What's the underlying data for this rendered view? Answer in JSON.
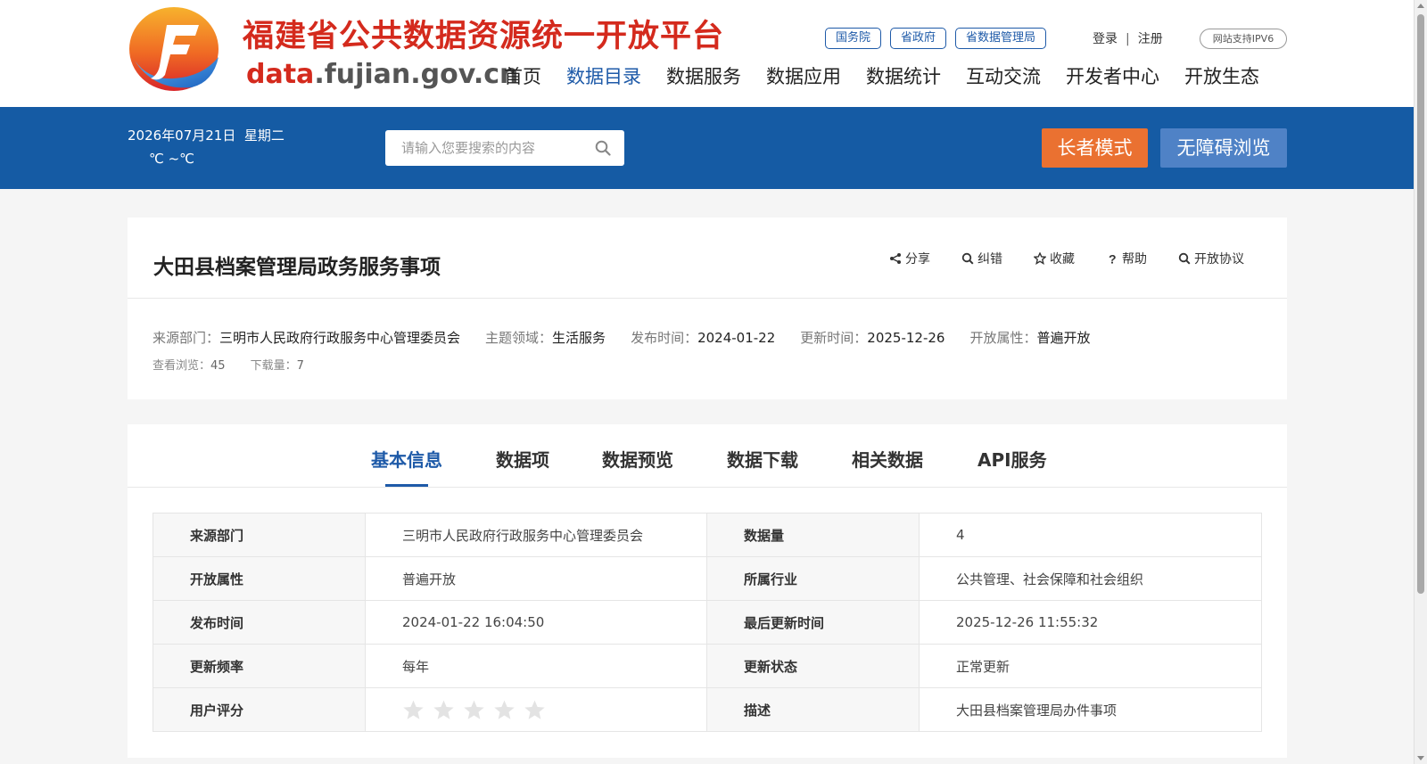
{
  "header": {
    "site_title": "福建省公共数据资源统一开放平台",
    "domain_prefix": "data",
    "domain_rest": ".fujian.gov.cn",
    "gov_links": [
      "国务院",
      "省政府",
      "省数据管理局"
    ],
    "login": "登录",
    "separator": "|",
    "register": "注册",
    "ipv6_badge": "网站支持IPV6",
    "nav": [
      "首页",
      "数据目录",
      "数据服务",
      "数据应用",
      "数据统计",
      "互动交流",
      "开发者中心",
      "开放生态"
    ],
    "nav_active_index": 1
  },
  "topbar": {
    "date": "2026年07月21日",
    "weekday": "星期二",
    "temperature": "℃ ~℃",
    "search_placeholder": "请输入您要搜索的内容",
    "elder_mode": "长者模式",
    "accessible_mode": "无障碍浏览"
  },
  "dataset": {
    "title": "大田县档案管理局政务服务事项",
    "actions": [
      "分享",
      "纠错",
      "收藏",
      "帮助",
      "开放协议"
    ],
    "meta": {
      "source_label": "来源部门：",
      "source_value": "三明市人民政府行政服务中心管理委员会",
      "theme_label": "主题领域：",
      "theme_value": "生活服务",
      "publish_label": "发布时间：",
      "publish_value": "2024-01-22",
      "update_label": "更新时间：",
      "update_value": "2025-12-26",
      "open_label": "开放属性：",
      "open_value": "普遍开放"
    },
    "stats": {
      "views_label": "查看浏览：",
      "views_value": "45",
      "downloads_label": "下载量：",
      "downloads_value": "7"
    }
  },
  "tabs": [
    "基本信息",
    "数据项",
    "数据预览",
    "数据下载",
    "相关数据",
    "API服务"
  ],
  "tab_active_index": 0,
  "info_table": [
    {
      "k1": "来源部门",
      "v1": "三明市人民政府行政服务中心管理委员会",
      "k2": "数据量",
      "v2": "4"
    },
    {
      "k1": "开放属性",
      "v1": "普遍开放",
      "k2": "所属行业",
      "v2": "公共管理、社会保障和社会组织"
    },
    {
      "k1": "发布时间",
      "v1": "2024-01-22 16:04:50",
      "k2": "最后更新时间",
      "v2": "2025-12-26 11:55:32"
    },
    {
      "k1": "更新频率",
      "v1": "每年",
      "k2": "更新状态",
      "v2": "正常更新"
    },
    {
      "k1": "用户评分",
      "v1": "",
      "k2": "描述",
      "v2": "大田县档案管理局办件事项"
    }
  ],
  "rating": {
    "stars_filled": 0,
    "stars_total": 5
  },
  "colors": {
    "primary": "#155ba4",
    "accent_red": "#d42a1d",
    "elder_orange": "#ea7131",
    "access_blue": "#4f82c6"
  }
}
